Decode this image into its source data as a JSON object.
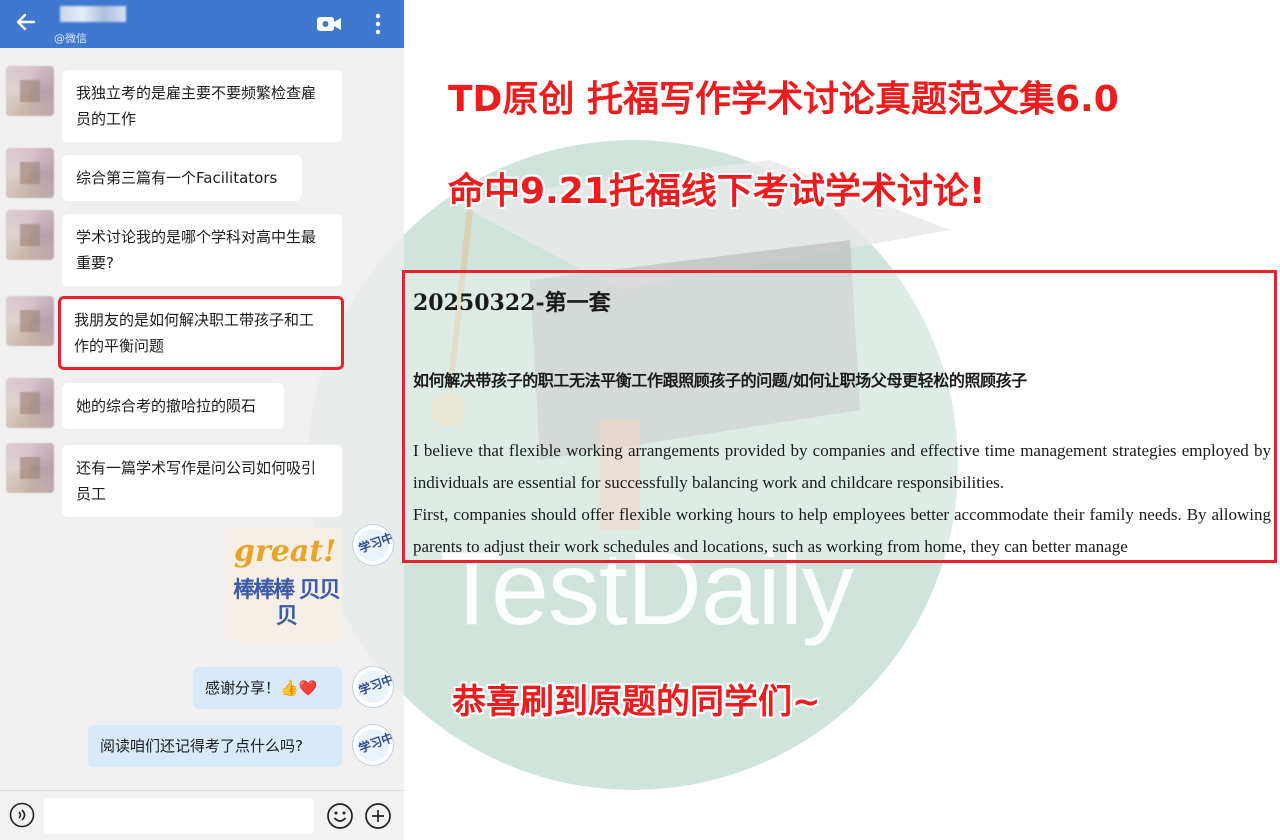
{
  "chat": {
    "contact_source": "@微信",
    "messages": [
      "我独立考的是雇主要不要频繁检查雇员的工作",
      "综合第三篇有一个Facilitators",
      "学术讨论我的是哪个学科对高中生最重要?",
      "我朋友的是如何解决职工带孩子和工作的平衡问题",
      "她的综合考的撤哈拉的陨石",
      "还有一篇学术写作是问公司如何吸引员工"
    ],
    "sticker": {
      "headline": "great!",
      "caption": "棒棒棒 贝贝贝"
    },
    "my_messages": [
      "感谢分享！👍❤️",
      "阅读咱们还记得考了点什么吗?"
    ],
    "bot_avatar_text": "学习中"
  },
  "promo": {
    "line1": "TD原创 托福写作学术讨论真题范文集6.0",
    "line2": "命中9.21托福线下考试学术讨论!",
    "line3": "恭喜刷到原题的同学们~"
  },
  "doc": {
    "title": "20250322-第一套",
    "subtitle": "如何解决带孩子的职工无法平衡工作跟照顾孩子的问题/如何让职场父母更轻松的照顾孩子",
    "para1": "I believe that flexible working arrangements provided by companies and effective time management strategies employed by individuals are essential for successfully balancing work and childcare responsibilities.",
    "para2": "First, companies should offer flexible working hours to help employees better accommodate their family needs. By allowing parents to adjust their work schedules and locations, such as working from home, they can better manage"
  },
  "watermark": "TestDaily",
  "colors": {
    "topbar": "#3f78cf",
    "highlight": "#e8232b",
    "promo_text": "#ee1c1c",
    "watermark_circle": "#cfe5dc"
  }
}
